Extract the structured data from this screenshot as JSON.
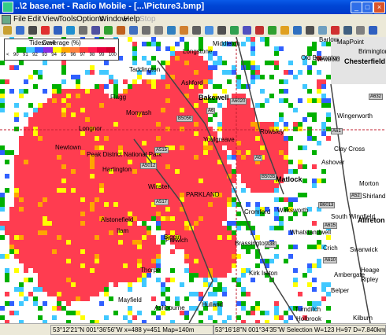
{
  "window": {
    "title": "..\\2 base.net - Radio Mobile - [...\\Picture3.bmp]",
    "minimize_glyph": "_",
    "maximize_glyph": "□",
    "close_glyph": "×"
  },
  "menu": {
    "items": [
      "File",
      "Edit",
      "View",
      "Tools",
      "Options",
      "Window",
      "Help",
      "Stop"
    ],
    "disabled": [
      "Stop"
    ]
  },
  "legend": {
    "title": "Coverage (%)",
    "ticks": [
      "<",
      "90",
      "91",
      "92",
      "93",
      "94",
      "95",
      "96",
      "97",
      "98",
      "99",
      "100"
    ],
    "colors": [
      "#ffffff",
      "#00b000",
      "#40c8ff",
      "#3060ff",
      "#8a2be2",
      "#ffff00",
      "#ffa500",
      "#ff8040",
      "#ff3c3c",
      "#ff1e50",
      "#e8003c",
      "#d0002c"
    ]
  },
  "places": [
    "Tideswell",
    "Middleton",
    "Longstone",
    "Barlow",
    "Old Brampton",
    "Newbold",
    "Brimington",
    "Chesterfield",
    "MapPoint",
    "Taddington",
    "Ashford",
    "Flagg",
    "Monyash",
    "Bakewell",
    "Wingerworth",
    "Longnor",
    "Rowsley",
    "Newtown",
    "Youlgreave",
    "Clay Cross",
    "Peak District National Park",
    "Ashover",
    "Hartington",
    "Matlock",
    "Morton",
    "Winster",
    "Wirksworth",
    "Shirland",
    "PARKLAND",
    "Cromford",
    "South Wingfield",
    "Alfreton",
    "Biggin",
    "Whatstandwell",
    "Crich",
    "Parwich",
    "Brassington",
    "Swanwick",
    "Alstonefield",
    "Ilam",
    "Heage",
    "Ripley",
    "Thorpe",
    "Kirk Ireton",
    "Ambergate",
    "Belper",
    "Mayfield",
    "Ashbourne",
    "Hulland",
    "Turnditch",
    "Kilburn",
    "Holbrook"
  ],
  "road_labels": [
    "A6",
    "A6020",
    "A632",
    "A61",
    "B5056",
    "A515",
    "A5012",
    "A6",
    "B5035",
    "A52",
    "A517",
    "A38",
    "A610",
    "B6013",
    "A615"
  ],
  "status": {
    "left": "53°12'21\"N 001°36'56\"W  x=488 y=451 Map=140m",
    "right": "53°16'18\"N 001°34'35\"W Selection W=123 H=97 D=7.840km Az=128"
  }
}
